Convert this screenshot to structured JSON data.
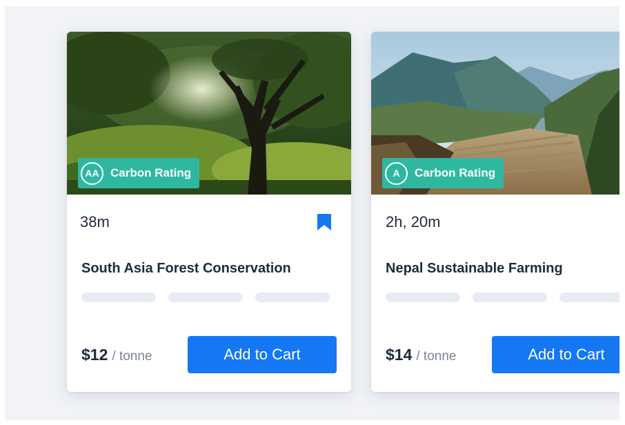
{
  "cards": [
    {
      "image": "forest-tree-photo",
      "rating_grade": "AA",
      "rating_label": "Carbon Rating",
      "duration": "38m",
      "title": "South Asia Forest Conservation",
      "price": "$12",
      "price_unit": "/ tonne",
      "cart_label": "Add to Cart",
      "bookmark_icon": "bookmark-icon",
      "bookmarked": true
    },
    {
      "image": "nepal-mountain-terraces-photo",
      "rating_grade": "A",
      "rating_label": "Carbon Rating",
      "duration": "2h, 20m",
      "title": "Nepal Sustainable Farming",
      "price": "$14",
      "price_unit": "/ tonne",
      "cart_label": "Add to Cart"
    }
  ],
  "colors": {
    "accent": "#1478f2",
    "rating_badge": "#2fb8a0",
    "text": "#1f2a3c",
    "muted": "#7a8594",
    "placeholder": "#e6ecf3",
    "background": "#f1f3f7"
  }
}
